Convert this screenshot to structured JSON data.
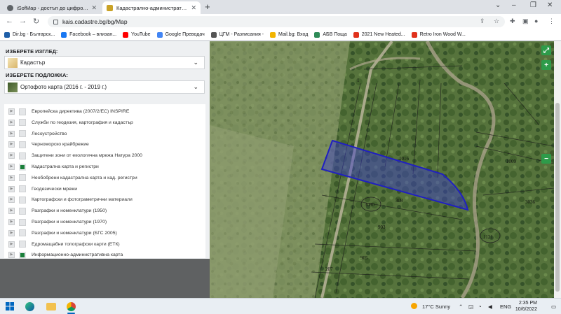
{
  "browser": {
    "tabs": [
      {
        "title": "iSofMap - достъп до цифрови д...",
        "active": false
      },
      {
        "title": "Кадастрално-административна...",
        "active": true
      }
    ],
    "url": "kais.cadastre.bg/bg/Map",
    "bookmarks": [
      {
        "label": "Dir.bg - Българск...",
        "color": "#1f5fa8"
      },
      {
        "label": "Facebook – влизан...",
        "color": "#1877f2"
      },
      {
        "label": "YouTube",
        "color": "#ff0000"
      },
      {
        "label": "Google Преводач",
        "color": "#4285f4"
      },
      {
        "label": "ЦГМ - Разписания -",
        "color": "#555555"
      },
      {
        "label": "Mail.bg: Вход",
        "color": "#f2b400"
      },
      {
        "label": "АБВ Поща",
        "color": "#2e8b57"
      },
      {
        "label": "2021 New Heated...",
        "color": "#e0311b"
      },
      {
        "label": "Retro Iron Wood W...",
        "color": "#e0311b"
      }
    ]
  },
  "panel": {
    "view_heading": "ИЗБЕРЕТЕ ИЗГЛЕД:",
    "view_value": "Кадастър",
    "base_heading": "ИЗБЕРЕТЕ ПОДЛОЖКА:",
    "base_value": "Ортофото карта (2016 г. - 2019 г.)",
    "layers": [
      {
        "label": "Европейска директива (2007/2/ЕС) INSPIRE",
        "checked": false
      },
      {
        "label": "Служби по геодезия, картография и кадастър",
        "checked": false
      },
      {
        "label": "Лесоустройство",
        "checked": false
      },
      {
        "label": "Черноморско крайбрежие",
        "checked": false
      },
      {
        "label": "Защитени зони от екологична мрежа Натура 2000",
        "checked": false
      },
      {
        "label": "Кадастрална карта и регистри",
        "checked": true
      },
      {
        "label": "Необобрени кадастрална карта и кад. регистри",
        "checked": false
      },
      {
        "label": "Геодезически мрежи",
        "checked": false
      },
      {
        "label": "Картографски и фотограметрични материали",
        "checked": false
      },
      {
        "label": "Разграфки и номенклатури (1950)",
        "checked": false
      },
      {
        "label": "Разграфки и номенклатури (1970)",
        "checked": false
      },
      {
        "label": "Разграфки и номенклатури (БГС 2005)",
        "checked": false
      },
      {
        "label": "Едромащабни топографски карти (ЕТК)",
        "checked": false
      },
      {
        "label": "Информационно-административна карта",
        "checked": true
      }
    ]
  },
  "map": {
    "parcel_labels": [
      "3080",
      "1121",
      "1009",
      "3036",
      "903",
      "905",
      "207",
      "1016",
      "308",
      "1"
    ],
    "controls": [
      "expand-icon",
      "zoom-in-icon",
      "zoom-out-icon"
    ],
    "highlight_color": "#2020c0"
  },
  "taskbar": {
    "weather": "17°C  Sunny",
    "language": "ENG",
    "time": "2:35 PM",
    "date": "10/6/2022"
  }
}
